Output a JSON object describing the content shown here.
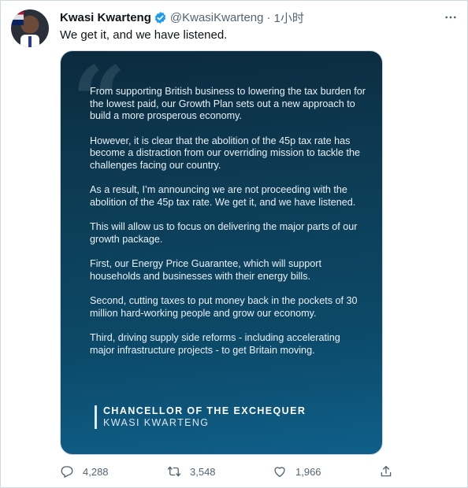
{
  "author": {
    "name": "Kwasi Kwarteng",
    "handle": "@KwasiKwarteng",
    "separator": "·",
    "time": "1小时"
  },
  "tweet": {
    "text": "We get it, and we have listened."
  },
  "image_card": {
    "paragraphs": [
      "From supporting British business to lowering the tax burden for the lowest paid, our Growth Plan sets out a new approach to build a more prosperous economy.",
      "However, it is clear that the abolition of the 45p tax rate has become a distraction from our overriding mission to tackle the challenges facing our country.",
      "As a result, I’m announcing we are not proceeding with the abolition of the 45p tax rate. We get it, and we have listened.",
      "This will allow us to focus on delivering the major parts of our growth package.",
      "First, our Energy Price Guarantee, which will support households and businesses with their energy bills.",
      "Second, cutting taxes to put money back in the pockets of 30 million hard-working people and grow our economy.",
      "Third, driving supply side reforms - including accelerating major infrastructure projects - to get Britain moving."
    ],
    "signature_title": "CHANCELLOR OF THE EXCHEQUER",
    "signature_name": "KWASI KWARTENG"
  },
  "actions": {
    "replies": "4,288",
    "retweets": "3,548",
    "likes": "1,966"
  },
  "icons": {
    "verified": "verified-badge-icon",
    "more": "more-options-icon",
    "reply": "reply-icon",
    "retweet": "retweet-icon",
    "like": "heart-icon",
    "share": "share-icon"
  },
  "colors": {
    "verified_blue": "#1d9bf0",
    "secondary_text": "#536471",
    "card_dark": "#0b2a3e",
    "card_light": "#0f5f8a"
  }
}
